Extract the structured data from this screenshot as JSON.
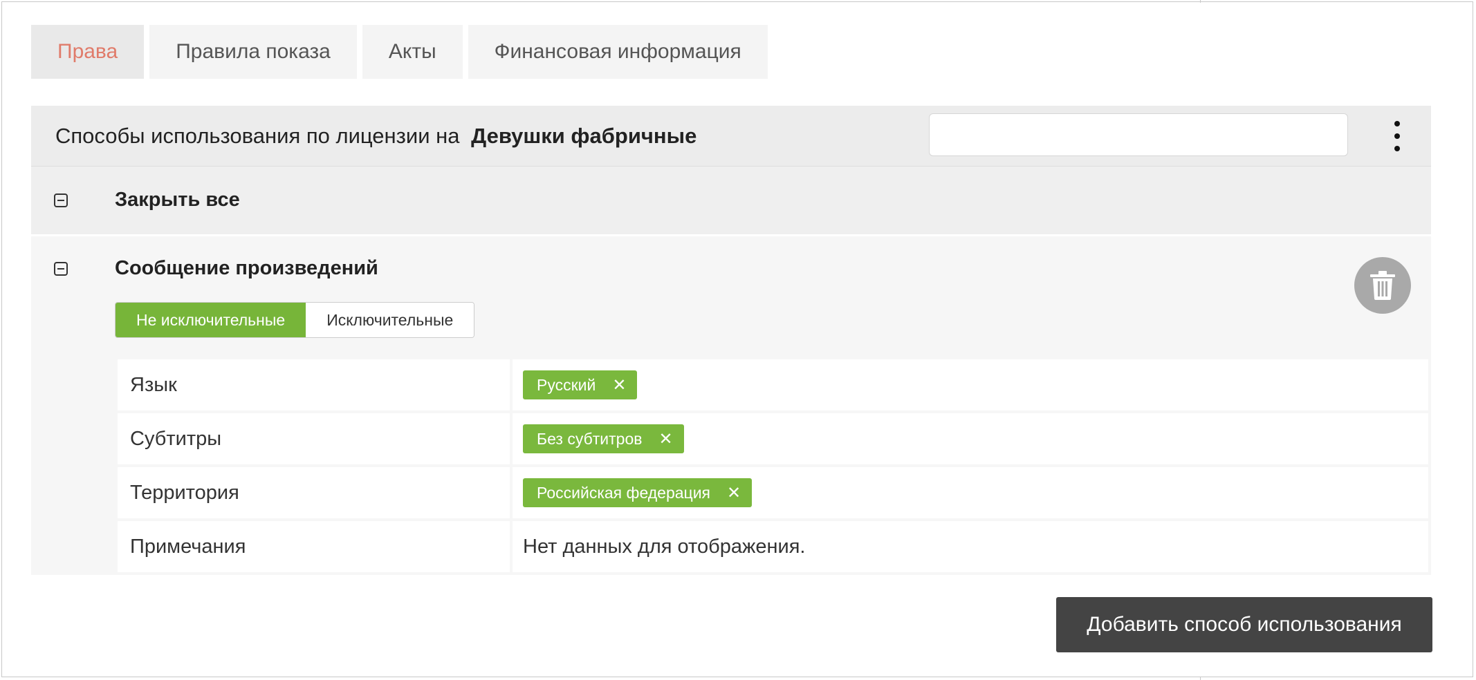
{
  "tabs": [
    {
      "label": "Права",
      "active": true
    },
    {
      "label": "Правила показа",
      "active": false
    },
    {
      "label": "Акты",
      "active": false
    },
    {
      "label": "Финансовая информация",
      "active": false
    }
  ],
  "panel": {
    "title_prefix": "Способы использования по лицензии на",
    "title_name": "Девушки фабричные",
    "search_value": "",
    "more_icon": "kebab-vertical-icon"
  },
  "collapse_all": {
    "label": "Закрыть все",
    "icon": "collapse-icon"
  },
  "section": {
    "title": "Сообщение произведений",
    "icon": "collapse-icon",
    "delete_icon": "trash-icon",
    "rights_toggle": {
      "options": [
        "Не исключительные",
        "Исключительные"
      ],
      "selected": "Не исключительные"
    },
    "rows": [
      {
        "label": "Язык",
        "chips": [
          "Русский"
        ]
      },
      {
        "label": "Субтитры",
        "chips": [
          "Без субтитров"
        ]
      },
      {
        "label": "Территория",
        "chips": [
          "Российская федерация"
        ]
      },
      {
        "label": "Примечания",
        "text": "Нет данных для отображения."
      }
    ],
    "chip_remove_glyph": "✕"
  },
  "add_button_label": "Добавить способ использования",
  "colors": {
    "accent_green": "#77b539",
    "active_tab_text": "#e07b6a",
    "dark_button": "#444444",
    "trash_circle": "#a9a9a9"
  }
}
